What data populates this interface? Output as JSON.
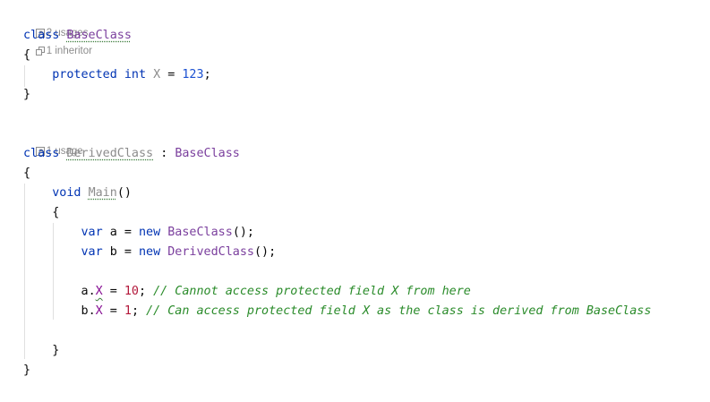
{
  "hints": {
    "base_usages": "2 usages",
    "base_inheritors": "1 inheritor",
    "derived_usages": "1 usage"
  },
  "code": {
    "kw_class": "class",
    "base_class_name": "BaseClass",
    "open_brace": "{",
    "close_brace": "}",
    "kw_protected": "protected",
    "kw_int": "int",
    "field_x": "X",
    "equals": "=",
    "value_123": "123",
    "semicolon": ";",
    "derived_class_name": "DerivedClass",
    "colon": ":",
    "kw_void": "void",
    "method_main": "Main",
    "parens": "()",
    "kw_var": "var",
    "var_a": "a",
    "var_b": "b",
    "kw_new": "new",
    "call_end": "();",
    "dot": ".",
    "value_10": "10",
    "value_1": "1",
    "comment_1": "// Cannot access protected field X from here",
    "comment_2": "// Can access protected field X as the class is derived from BaseClass"
  },
  "icons": {
    "usages_icon": "arrow-box-icon",
    "inheritor_icon": "inheritor-icon"
  },
  "colors": {
    "keyword": "#0033b3",
    "type": "#7a3e9d",
    "unused": "#8c8c8c",
    "number": "#1a4fd1",
    "comment": "#2a8b2a"
  }
}
